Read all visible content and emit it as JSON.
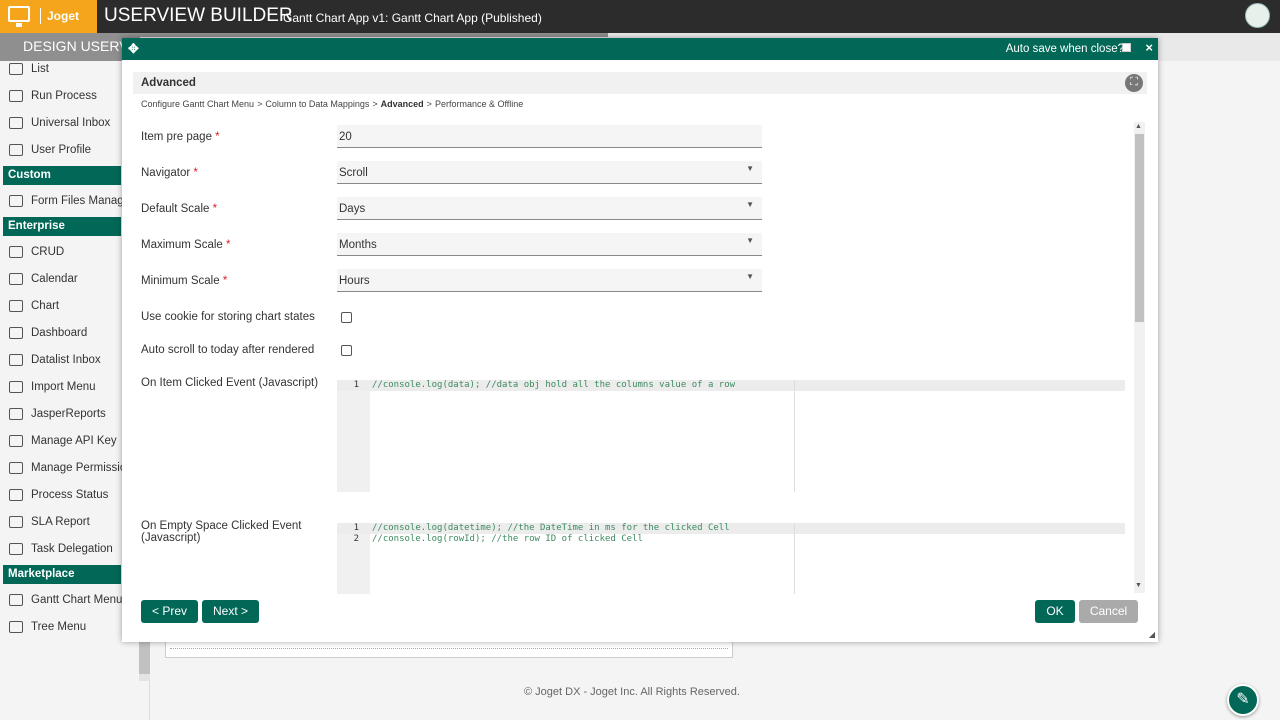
{
  "header": {
    "logo_text": "Joget",
    "title": "USERVIEW BUILDER",
    "subtitle": "Gantt Chart App v1: Gantt Chart App (Published)"
  },
  "subbar": {
    "design_tab": "DESIGN USERV"
  },
  "sidebar": {
    "items_top": [
      {
        "label": "List",
        "icon": "list-icon"
      },
      {
        "label": "Run Process",
        "icon": "play-icon"
      },
      {
        "label": "Universal Inbox",
        "icon": "inbox-icon"
      },
      {
        "label": "User Profile",
        "icon": "user-icon"
      }
    ],
    "custom_header": "Custom",
    "custom_items": [
      {
        "label": "Form Files Manager",
        "icon": "form-icon"
      }
    ],
    "enterprise_header": "Enterprise",
    "enterprise_items": [
      {
        "label": "CRUD",
        "icon": "crud-icon"
      },
      {
        "label": "Calendar",
        "icon": "calendar-icon"
      },
      {
        "label": "Chart",
        "icon": "chart-icon"
      },
      {
        "label": "Dashboard",
        "icon": "dashboard-icon"
      },
      {
        "label": "Datalist Inbox",
        "icon": "inbox-icon"
      },
      {
        "label": "Import Menu",
        "icon": "import-icon"
      },
      {
        "label": "JasperReports",
        "icon": "report-icon"
      },
      {
        "label": "Manage API Key",
        "icon": "monitor-icon"
      },
      {
        "label": "Manage Permission",
        "icon": "users-icon"
      },
      {
        "label": "Process Status",
        "icon": "process-icon"
      },
      {
        "label": "SLA Report",
        "icon": "report-icon"
      },
      {
        "label": "Task Delegation",
        "icon": "user-icon"
      }
    ],
    "marketplace_header": "Marketplace",
    "marketplace_items": [
      {
        "label": "Gantt Chart Menu",
        "icon": "form-icon"
      },
      {
        "label": "Tree Menu",
        "icon": "form-icon"
      }
    ]
  },
  "footer": {
    "copyright": "© Joget DX - Joget Inc. All Rights Reserved."
  },
  "dialog": {
    "autosave_label": "Auto save when close?",
    "autosave_checked": false,
    "close": "×",
    "section_title": "Advanced",
    "breadcrumb": [
      {
        "label": "Configure Gantt Chart Menu",
        "active": false
      },
      {
        "label": "Column to Data Mappings",
        "active": false
      },
      {
        "label": "Advanced",
        "active": true
      },
      {
        "label": "Performance & Offline",
        "active": false
      }
    ],
    "fields": {
      "item_per_page": {
        "label": "Item pre page",
        "required": "*",
        "value": "20"
      },
      "navigator": {
        "label": "Navigator",
        "required": "*",
        "value": "Scroll"
      },
      "default_scale": {
        "label": "Default Scale",
        "required": "*",
        "value": "Days"
      },
      "maximum_scale": {
        "label": "Maximum Scale",
        "required": "*",
        "value": "Months"
      },
      "minimum_scale": {
        "label": "Minimum Scale",
        "required": "*",
        "value": "Hours"
      },
      "use_cookie": {
        "label": "Use cookie for storing chart states",
        "checked": false
      },
      "auto_scroll": {
        "label": "Auto scroll to today after rendered",
        "checked": false
      },
      "on_item_clicked": {
        "label": "On Item Clicked Event (Javascript)",
        "lines": [
          {
            "num": "1",
            "text": "//console.log(data); //data obj hold all the columns value of a row"
          }
        ]
      },
      "on_empty_clicked": {
        "label_line1": "On Empty Space Clicked Event",
        "label_line2": "(Javascript)",
        "lines": [
          {
            "num": "1",
            "text": "//console.log(datetime); //the DateTime in ms for the clicked Cell"
          },
          {
            "num": "2",
            "text": "//console.log(rowId); //the row ID of clicked Cell"
          }
        ]
      }
    },
    "buttons": {
      "prev": "< Prev",
      "next": "Next >",
      "ok": "OK",
      "cancel": "Cancel"
    }
  }
}
